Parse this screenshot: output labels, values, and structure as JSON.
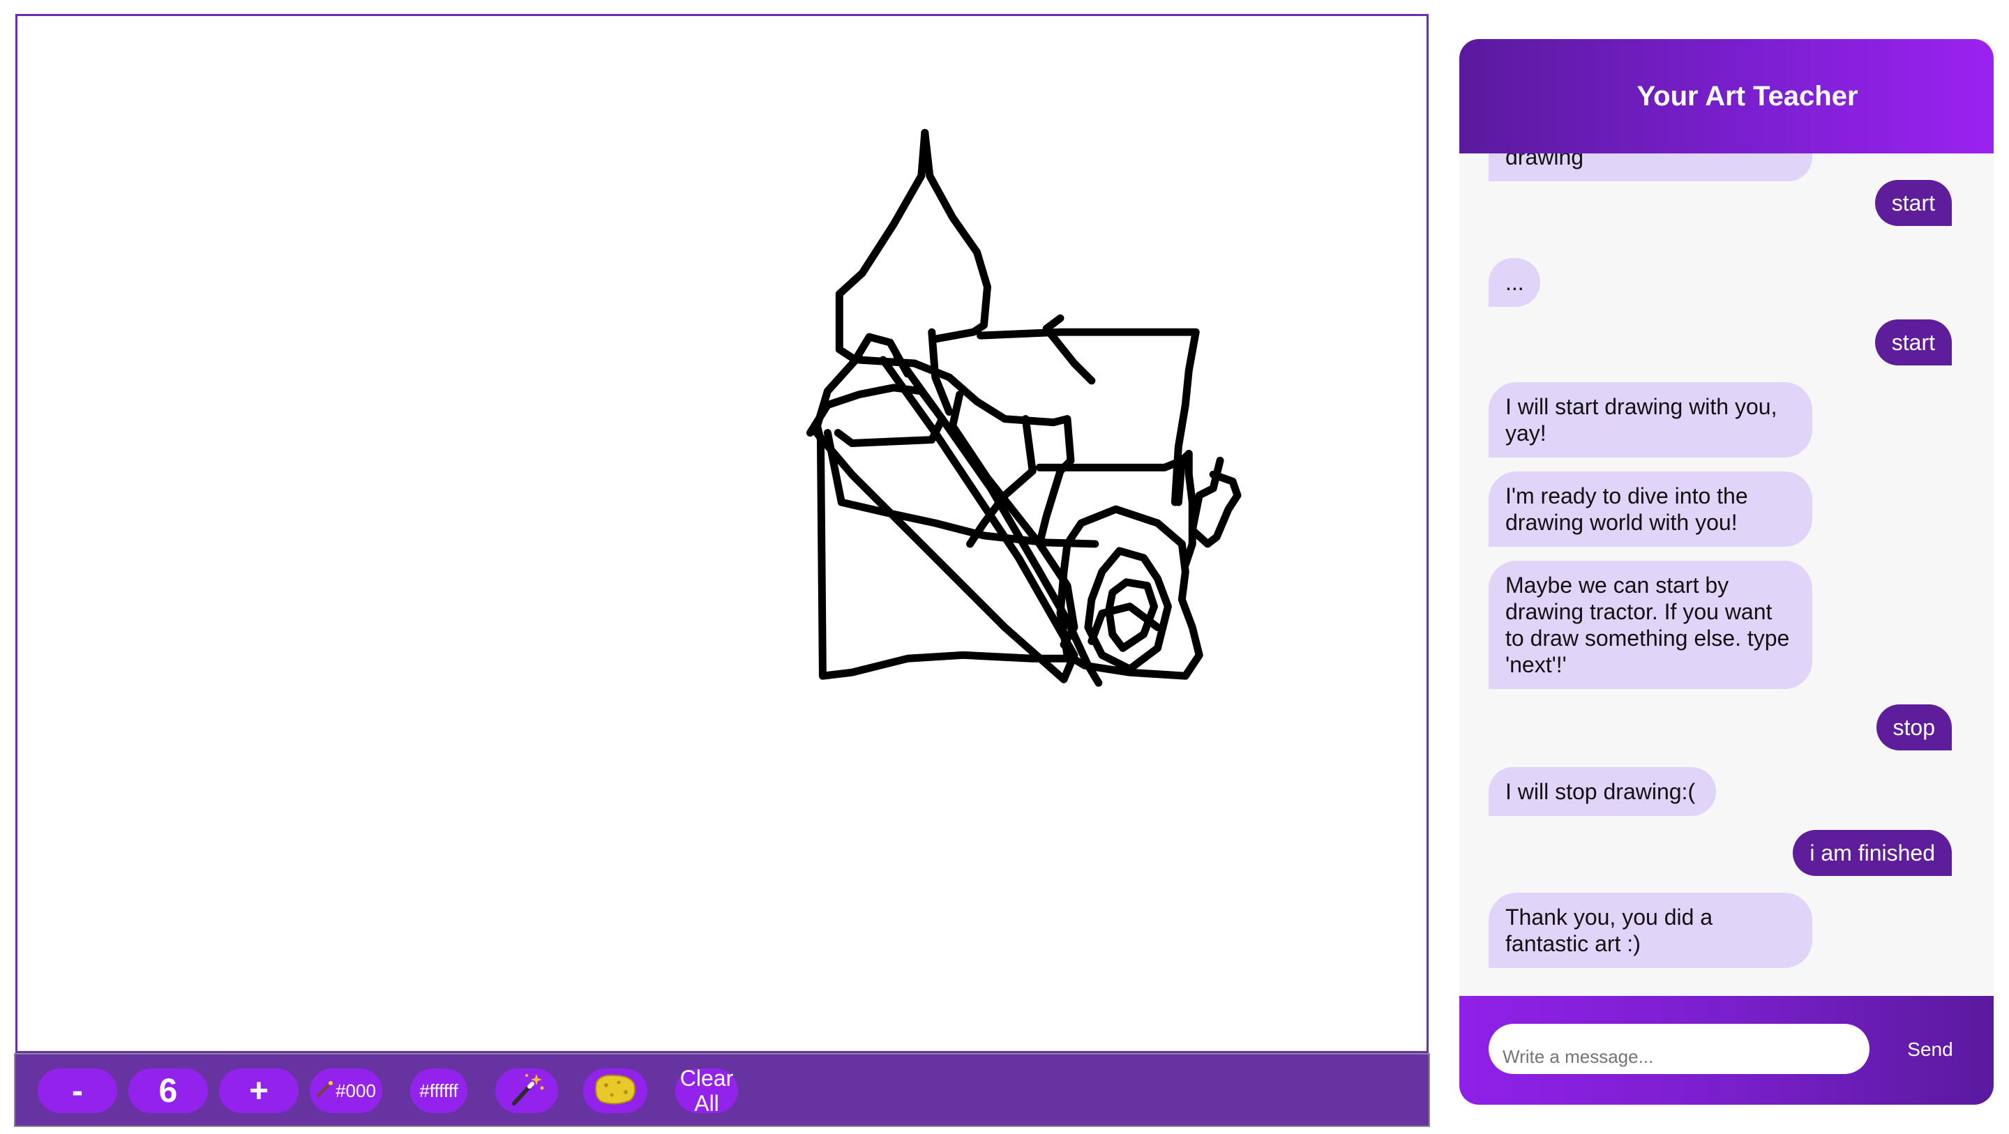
{
  "chat": {
    "title": "Your Art Teacher",
    "messages": [
      {
        "role": "bot",
        "text": "drawing"
      },
      {
        "role": "user",
        "text": "start"
      },
      {
        "role": "bot",
        "text": "..."
      },
      {
        "role": "user",
        "text": "start"
      },
      {
        "role": "bot",
        "text": "I will start drawing with you, yay!"
      },
      {
        "role": "bot",
        "text": "I'm ready to dive into the drawing world with you!"
      },
      {
        "role": "bot",
        "text": "Maybe we can start by drawing tractor. If you want to draw something else. type 'next'!'"
      },
      {
        "role": "user",
        "text": "stop"
      },
      {
        "role": "bot",
        "text": "I will stop drawing:("
      },
      {
        "role": "user",
        "text": "i am finished"
      },
      {
        "role": "bot",
        "text": "Thank you, you did a fantastic art :)"
      }
    ],
    "input_placeholder": "Write a message...",
    "send_label": "Send"
  },
  "toolbar": {
    "decrease_label": "-",
    "brush_size": "6",
    "increase_label": "+",
    "brush_color": "#000",
    "background_color": "#ffffff",
    "magic_icon": "magic-wand-icon",
    "eraser_icon": "sponge-icon",
    "clear_label_line1": "Clear",
    "clear_label_line2": "All"
  },
  "colors": {
    "accent": "#9323ec",
    "toolbar_bg": "#6633a0",
    "user_bubble": "#5e1d9a",
    "bot_bubble": "#e0d5f9",
    "stroke": "#000000"
  }
}
